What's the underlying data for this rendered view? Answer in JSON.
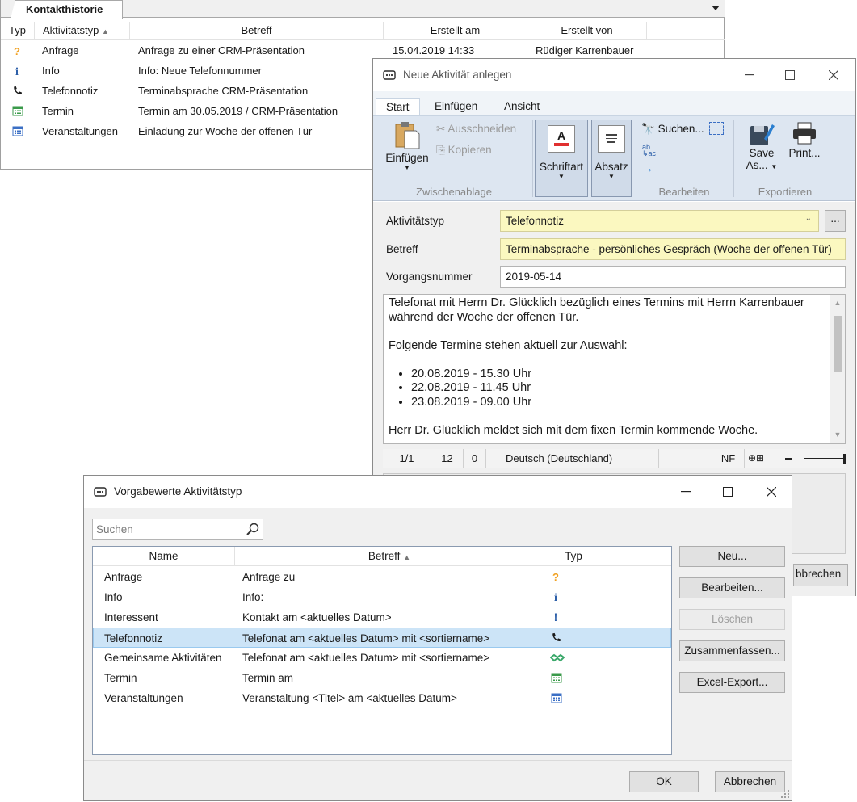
{
  "contact_history": {
    "tab": "Kontakthistorie",
    "columns": [
      "Typ",
      "Aktivitätstyp",
      "Betreff",
      "Erstellt am",
      "Erstellt von"
    ],
    "sort_indicator": "▲",
    "rows": [
      {
        "icon": "question-icon",
        "type": "Anfrage",
        "subject": "Anfrage zu einer CRM-Präsentation",
        "created": "15.04.2019 14:33",
        "by": "Rüdiger Karrenbauer"
      },
      {
        "icon": "info-icon",
        "type": "Info",
        "subject": "Info: Neue Telefonnummer",
        "created": "",
        "by": ""
      },
      {
        "icon": "phone-icon",
        "type": "Telefonnotiz",
        "subject": "Terminabsprache CRM-Präsentation",
        "created": "",
        "by": ""
      },
      {
        "icon": "calendar-icon",
        "type": "Termin",
        "subject": "Termin am 30.05.2019 / CRM-Präsentation",
        "created": "",
        "by": ""
      },
      {
        "icon": "calendar-blue-icon",
        "type": "Veranstaltungen",
        "subject": "Einladung zur Woche der offenen Tür",
        "created": "",
        "by": ""
      }
    ]
  },
  "new_activity": {
    "title": "Neue Aktivität anlegen",
    "ribbon_tabs": [
      "Start",
      "Einfügen",
      "Ansicht"
    ],
    "ribbon": {
      "paste": "Einfügen",
      "cut": "Ausschneiden",
      "copy": "Kopieren",
      "group_clipboard": "Zwischenablage",
      "font": "Schriftart",
      "paragraph": "Absatz",
      "search": "Suchen...",
      "group_edit": "Bearbeiten",
      "save_as_1": "Save",
      "save_as_2": "As...",
      "print": "Print...",
      "group_export": "Exportieren"
    },
    "fields": {
      "type_label": "Aktivitätstyp",
      "type_value": "Telefonnotiz",
      "more_button": "...",
      "subject_label": "Betreff",
      "subject_value": "Terminabsprache - persönliches Gespräch (Woche der offenen Tür)",
      "number_label": "Vorgangsnummer",
      "number_value": "2019-05-14"
    },
    "editor": {
      "p1": "Telefonat mit Herrn Dr. Glücklich bezüglich eines Termins mit Herrn Karrenbauer während der Woche der offenen Tür.",
      "p2": "Folgende Termine stehen aktuell zur Auswahl:",
      "bullets": [
        "20.08.2019 - 15.30 Uhr",
        "22.08.2019 - 11.45 Uhr",
        "23.08.2019 - 09.00 Uhr"
      ],
      "p3": "Herr Dr. Glücklich meldet sich mit dem fixen Termin kommende Woche."
    },
    "statusbar": {
      "page": "1/1",
      "words": "12",
      "chars": "0",
      "language": "Deutsch (Deutschland)",
      "mode": "NF"
    },
    "cancel_partial": "bbrechen"
  },
  "defaults_dialog": {
    "title": "Vorgabewerte Aktivitätstyp",
    "search_placeholder": "Suchen",
    "columns": [
      "Name",
      "Betreff",
      "Typ"
    ],
    "sort_indicator": "▲",
    "rows": [
      {
        "name": "Anfrage",
        "subject": "Anfrage zu",
        "icon": "question-icon"
      },
      {
        "name": "Info",
        "subject": "Info:",
        "icon": "info-icon"
      },
      {
        "name": "Interessent",
        "subject": "Kontakt am <aktuelles Datum>",
        "icon": "exclamation-icon"
      },
      {
        "name": "Telefonnotiz",
        "subject": "Telefonat am <aktuelles Datum> mit <sortiername>",
        "icon": "phone-icon"
      },
      {
        "name": "Gemeinsame Aktivitäten",
        "subject": "Telefonat am <aktuelles Datum> mit <sortiername>",
        "icon": "handshake-icon"
      },
      {
        "name": "Termin",
        "subject": "Termin am",
        "icon": "calendar-icon"
      },
      {
        "name": "Veranstaltungen",
        "subject": "Veranstaltung <Titel> am <aktuelles Datum>",
        "icon": "calendar-blue-icon"
      }
    ],
    "selected_row": "Telefonnotiz",
    "buttons": {
      "new": "Neu...",
      "edit": "Bearbeiten...",
      "delete": "Löschen",
      "merge": "Zusammenfassen...",
      "export": "Excel-Export..."
    },
    "ok": "OK",
    "cancel": "Abbrechen"
  },
  "colors": {
    "accent": "#0078d7",
    "selection": "#cce4f7",
    "ribbon": "#dde6f1",
    "highlight_field": "#fbf8c0",
    "calendar_green": "#3a9a4a",
    "question_orange": "#f0a020"
  }
}
